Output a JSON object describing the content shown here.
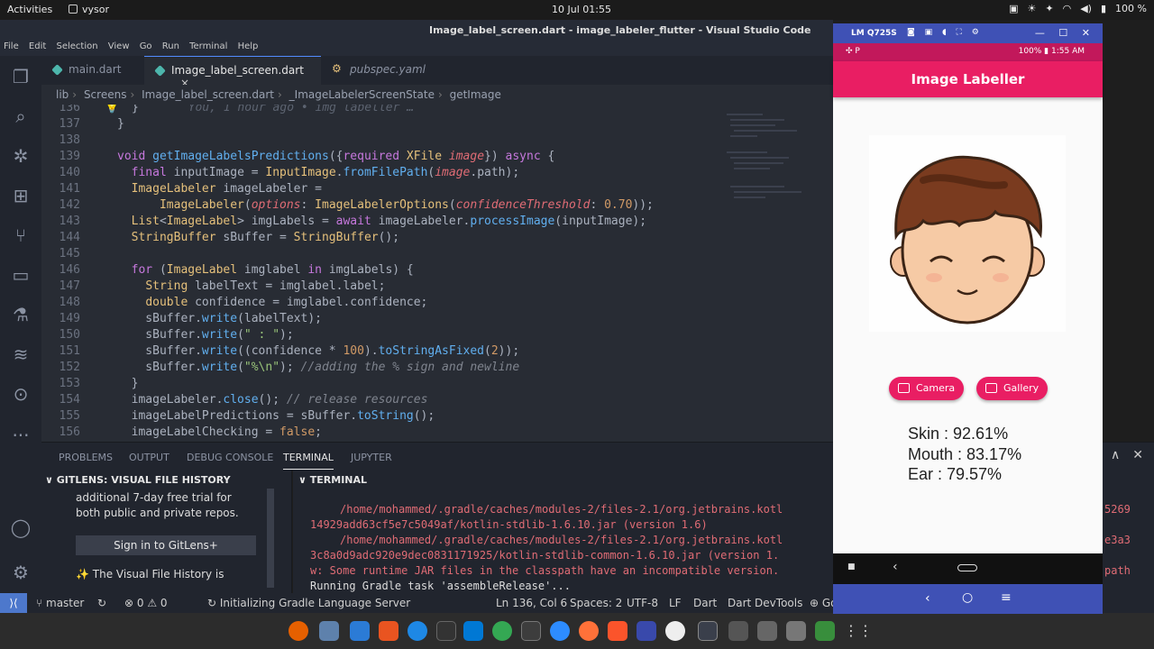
{
  "topbar": {
    "activities": "Activities",
    "app_name": "vysor",
    "clock": "10 Jul  01:55",
    "battery": "100 %"
  },
  "window": {
    "title": "Image_label_screen.dart - image_labeler_flutter - Visual Studio Code"
  },
  "menu": [
    "File",
    "Edit",
    "Selection",
    "View",
    "Go",
    "Run",
    "Terminal",
    "Help"
  ],
  "tabs": [
    {
      "label": "main.dart"
    },
    {
      "label": "Image_label_screen.dart",
      "close": "×"
    },
    {
      "label": "pubspec.yaml"
    }
  ],
  "breadcrumb": [
    "lib",
    "Screens",
    "Image_label_screen.dart",
    "_ImageLabelerScreenState",
    "getImage"
  ],
  "editor": {
    "gitlens_blame": "You, 1 hour ago • img labeller …",
    "line_numbers": [
      "136",
      "137",
      "138",
      "139",
      "140",
      "141",
      "142",
      "143",
      "144",
      "145",
      "146",
      "147",
      "148",
      "149",
      "150",
      "151",
      "152",
      "153",
      "154",
      "155",
      "156"
    ]
  },
  "panel": {
    "tabs": [
      "PROBLEMS",
      "OUTPUT",
      "DEBUG CONSOLE",
      "TERMINAL",
      "JUPYTER"
    ],
    "gitlens_header": "GITLENS: VISUAL FILE HISTORY",
    "gitlens_text": "additional 7-day free trial for both public and private repos.",
    "gitlens_signin": "Sign in to GitLens+",
    "gitlens_visual": "✨ The Visual File History is",
    "terminal_header": "TERMINAL",
    "terminal_lines": [
      "/home/mohammed/.gradle/caches/modules-2/files-2.1/org.jetbrains.kotl",
      "14929add63cf5e7c5049af/kotlin-stdlib-1.6.10.jar (version 1.6)",
      "/home/mohammed/.gradle/caches/modules-2/files-2.1/org.jetbrains.kotl",
      "3c8a0d9adc920e9dec0831171925/kotlin-stdlib-common-1.6.10.jar (version 1.",
      "w: Some runtime JAR files in the classpath have an incompatible version.",
      "Running Gradle task 'assembleRelease'..."
    ],
    "terminal_right": [
      "5269",
      "e3a3",
      "path"
    ]
  },
  "statusbar": {
    "branch": "master",
    "errors": "⊗ 0 ⚠ 0",
    "task": "Initializing Gradle Language Server",
    "position": "Ln 136, Col 6",
    "spaces": "Spaces: 2",
    "encoding": "UTF-8",
    "eol": "LF",
    "language": "Dart",
    "devtools": "Dart DevTools",
    "go": "Go"
  },
  "phone": {
    "device": "LM Q725S",
    "status_right": "100% ▮ 1:55 AM",
    "app_title": "Image Labeller",
    "camera_button": "Camera",
    "gallery_button": "Gallery",
    "results": [
      "Skin : 92.61%",
      "Mouth : 83.17%",
      "Ear : 79.57%"
    ]
  }
}
